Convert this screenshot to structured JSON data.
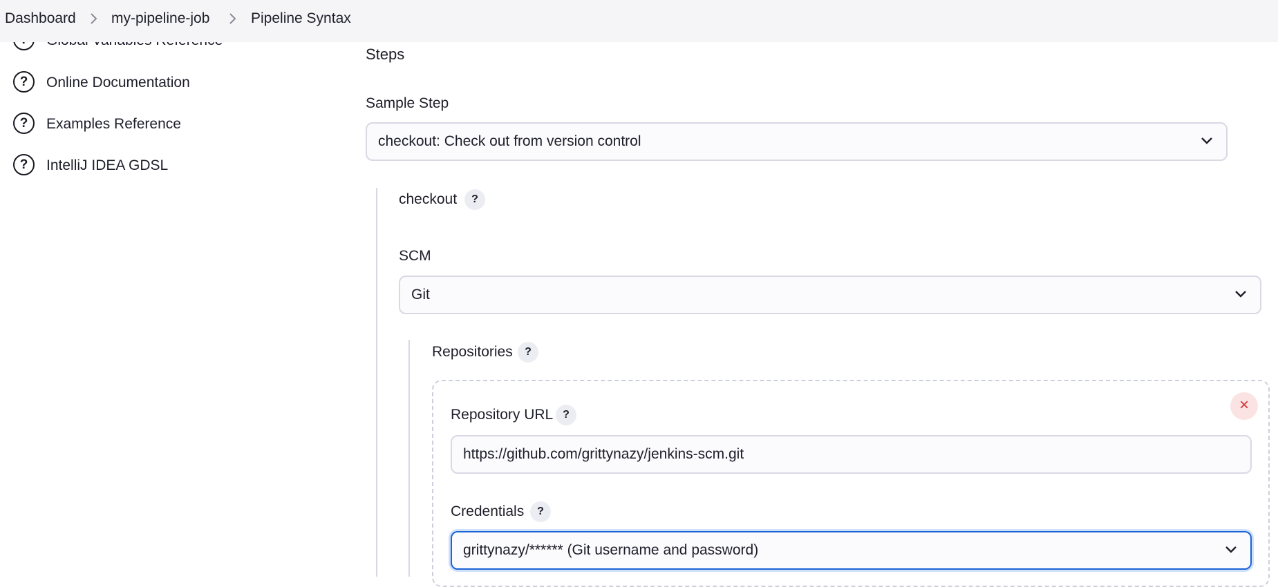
{
  "breadcrumb": {
    "items": [
      "Dashboard",
      "my-pipeline-job",
      "Pipeline Syntax"
    ]
  },
  "sidebar": {
    "items": [
      {
        "label": "Global Variables Reference",
        "icon": "help-circle-icon"
      },
      {
        "label": "Online Documentation",
        "icon": "help-circle-icon"
      },
      {
        "label": "Examples Reference",
        "icon": "help-circle-icon"
      },
      {
        "label": "IntelliJ IDEA GDSL",
        "icon": "help-circle-icon"
      }
    ]
  },
  "main": {
    "section_title": "Steps",
    "sample_step": {
      "label": "Sample Step",
      "value": "checkout: Check out from version control"
    },
    "checkout": {
      "label": "checkout",
      "help": "?"
    },
    "scm": {
      "label": "SCM",
      "value": "Git"
    },
    "repositories": {
      "label": "Repositories",
      "help": "?",
      "remove_icon": "×"
    },
    "repository_url": {
      "label": "Repository URL",
      "help": "?",
      "value": "https://github.com/grittynazy/jenkins-scm.git"
    },
    "credentials": {
      "label": "Credentials",
      "help": "?",
      "value": "grittynazy/****** (Git username and password)"
    }
  },
  "colors": {
    "focus": "#1a63d6",
    "remove": "#d62f2f",
    "topbar": "#f5f5f7"
  }
}
